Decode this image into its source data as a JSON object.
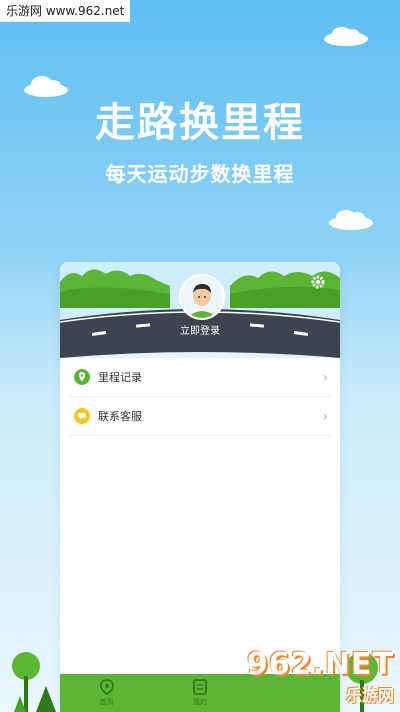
{
  "site_tag": "乐游网 www.962.net",
  "title": "走路换里程",
  "subtitle": "每天运动步数换里程",
  "app": {
    "login_label": "立即登录",
    "menu": [
      {
        "label": "里程记录",
        "icon": "location-pin-icon",
        "color": "#5db535"
      },
      {
        "label": "联系客服",
        "icon": "chat-bubble-icon",
        "color": "#f5c518"
      }
    ],
    "tabs": [
      {
        "label": "首页",
        "icon": "location-pin-icon"
      },
      {
        "label": "我的",
        "icon": "document-icon"
      }
    ]
  },
  "watermark": {
    "big": "962.NET",
    "small": "乐游网"
  },
  "colors": {
    "primary_green": "#5db535",
    "road": "#3d4350",
    "sky_top": "#5fbef2",
    "watermark_orange": "#f0872a"
  }
}
